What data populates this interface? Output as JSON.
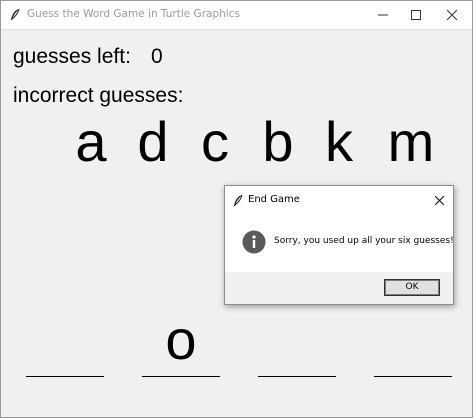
{
  "window": {
    "title": "Guess the Word Game in Turtle Graphics"
  },
  "canvas": {
    "guesses_left_label": "guesses left:",
    "guesses_left_value": "0",
    "incorrect_label": "incorrect guesses:",
    "incorrect_letters": [
      "a",
      "d",
      "c",
      "b",
      "k",
      "m"
    ],
    "word_slots": [
      "",
      "o",
      "",
      ""
    ]
  },
  "dialog": {
    "title": "End Game",
    "message": "Sorry, you used up all your six guesses!",
    "ok_label": "OK",
    "icon": "info-icon"
  },
  "colors": {
    "background": "#f0f0f0",
    "dialog_icon": "#5a5a5a"
  }
}
